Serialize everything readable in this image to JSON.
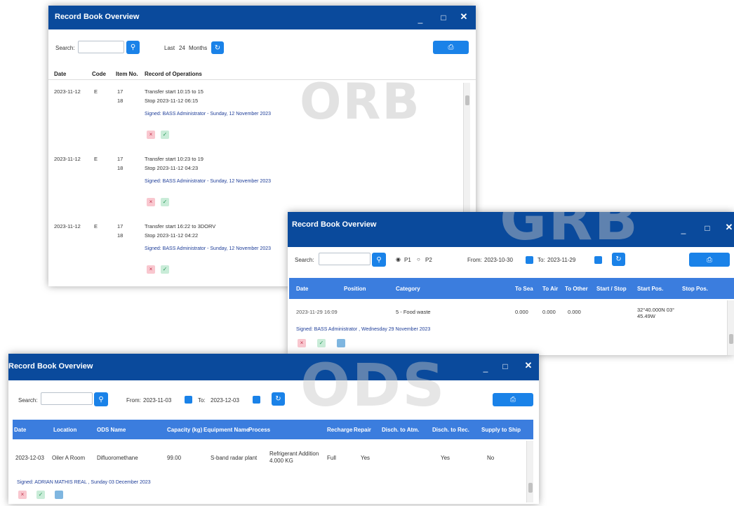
{
  "orb": {
    "title": "Record Book Overview",
    "watermark": "ORB",
    "search_label": "Search:",
    "last_label": "Last",
    "last_value": "24",
    "months_label": "Months",
    "columns": [
      "Date",
      "Code",
      "Item No.",
      "Record of Operations"
    ],
    "entries": [
      {
        "date": "2023-11-12",
        "code": "E",
        "items": [
          "17",
          "18"
        ],
        "lines": [
          "Transfer start 10:15 to 15",
          "Stop 2023-11-12 06:15"
        ],
        "signed": "Signed: BASS Administrator - Sunday, 12 November 2023"
      },
      {
        "date": "2023-11-12",
        "code": "E",
        "items": [
          "17",
          "18"
        ],
        "lines": [
          "Transfer start 10:23 to 19",
          "Stop 2023-11-12 04:23"
        ],
        "signed": "Signed: BASS Administrator - Sunday, 12 November 2023"
      },
      {
        "date": "2023-11-12",
        "code": "E",
        "items": [
          "17",
          "18"
        ],
        "lines": [
          "Transfer start 16:22 to 3DORV",
          "Stop 2023-11-12 04:22"
        ],
        "signed": "Signed: BASS Administrator - Sunday, 12 November 2023"
      }
    ]
  },
  "grb": {
    "title": "Record Book Overview",
    "watermark": "GRB",
    "search_label": "Search:",
    "radio_p1": "P1",
    "radio_p2": "P2",
    "from_label": "From:",
    "from_value": "2023-10-30",
    "to_label": "To:",
    "to_value": "2023-11-29",
    "columns": [
      "Date",
      "Position",
      "Category",
      "To Sea",
      "To Air",
      "To Other",
      "Start / Stop",
      "Start Pos.",
      "Stop Pos."
    ],
    "row": {
      "date": "2023-11-29 16:09",
      "position": "",
      "category": "5 - Food waste",
      "to_sea": "0.000",
      "to_air": "0.000",
      "to_other": "0.000",
      "start_stop": "",
      "start_pos_1": "32°40.000N 03°",
      "start_pos_2": "45.49W",
      "stop_pos": ""
    },
    "signed": "Signed: BASS Administrator , Wednesday 29 November 2023"
  },
  "ods": {
    "title": "Record Book Overview",
    "watermark": "ODS",
    "search_label": "Search:",
    "from_label": "From:",
    "from_value": "2023-11-03",
    "to_label": "To:",
    "to_value": "2023-12-03",
    "columns": [
      "Date",
      "Location",
      "ODS Name",
      "Capacity (kg)",
      "Equipment Name",
      "Process",
      "Recharge",
      "Repair",
      "Disch. to Atm.",
      "Disch. to Rec.",
      "Supply to Ship"
    ],
    "row": {
      "date": "2023-12-03",
      "location": "Oiler A Room",
      "ods_name": "Difluoromethane",
      "capacity": "99.00",
      "equipment": "S-band radar plant",
      "process_1": "Refrigerant Addition",
      "process_2": "4.000 KG",
      "recharge": "Full",
      "repair": "Yes",
      "disch_atm": "",
      "disch_rec": "Yes",
      "supply": "No"
    },
    "signed": "Signed: ADRIAN MATHIS REAL , Sunday 03 December 2023"
  }
}
